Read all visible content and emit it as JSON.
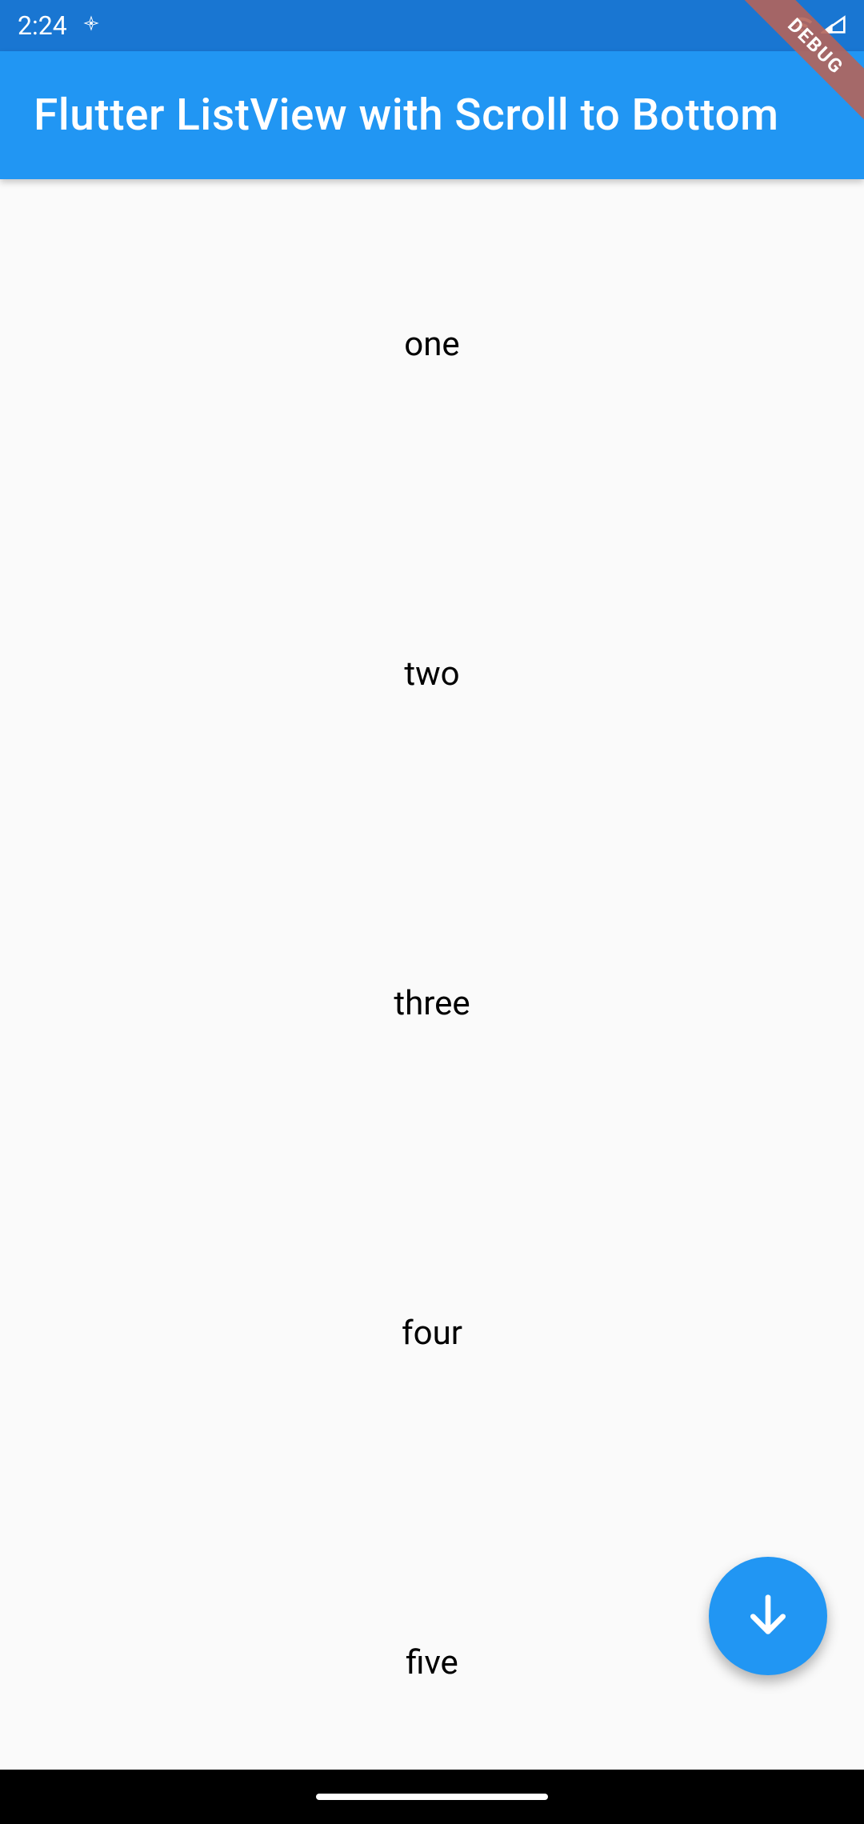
{
  "status_bar": {
    "time": "2:24"
  },
  "app_bar": {
    "title": "Flutter ListView with Scroll to Bottom"
  },
  "debug_banner": {
    "label": "DEBUG"
  },
  "list": {
    "items": [
      "one",
      "two",
      "three",
      "four",
      "five"
    ]
  },
  "colors": {
    "primary": "#2196F3",
    "primary_dark": "#1976D2",
    "background": "#fafafa"
  }
}
